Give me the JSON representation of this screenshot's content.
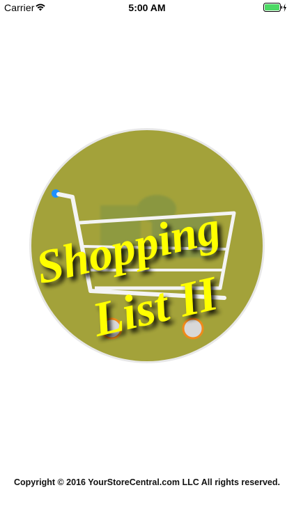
{
  "status_bar": {
    "carrier": "Carrier",
    "time": "5:00 AM",
    "icons": [
      "wifi-icon",
      "battery-icon",
      "charging-bolt-icon"
    ],
    "battery_color": "#4cd964"
  },
  "logo": {
    "text_line1": "Shopping",
    "text_line2": "List II",
    "circle_color": "#a3a23a",
    "text_color": "#ffff00",
    "icon": "shopping-cart-icon"
  },
  "footer": {
    "copyright": "Copyright © 2016 YourStoreCentral.com LLC All rights reserved."
  }
}
